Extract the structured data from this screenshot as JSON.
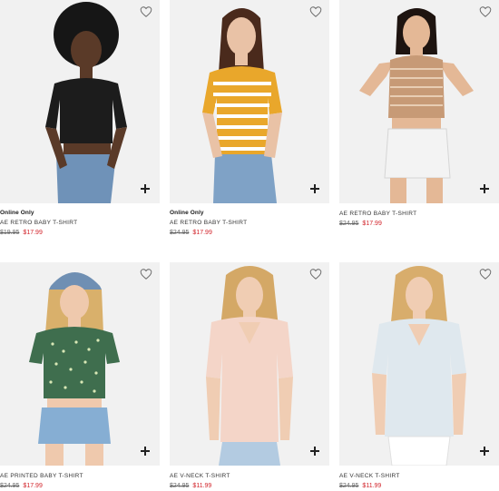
{
  "accent_color": "#d2232a",
  "products": [
    {
      "flag": "Online Only",
      "name": "AE RETRO BABY T-SHIRT",
      "old_price": "$19.95",
      "sale_price": "$17.99",
      "top_color": "#1c1c1c",
      "icons": [
        "heart-outline-icon",
        "plus-icon"
      ]
    },
    {
      "flag": "Online Only",
      "name": "AE RETRO BABY T-SHIRT",
      "old_price": "$24.95",
      "sale_price": "$17.99",
      "top_color": "#e9a72b",
      "icons": [
        "heart-outline-icon",
        "plus-icon"
      ]
    },
    {
      "flag": "",
      "name": "AE RETRO BABY T-SHIRT",
      "old_price": "$24.95",
      "sale_price": "$17.99",
      "top_color": "#c79a76",
      "icons": [
        "heart-outline-icon",
        "plus-icon"
      ]
    },
    {
      "flag": "",
      "name": "AE PRINTED BABY T-SHIRT",
      "old_price": "$24.95",
      "sale_price": "$17.99",
      "top_color": "#3f6e4e",
      "icons": [
        "heart-outline-icon",
        "plus-icon"
      ]
    },
    {
      "flag": "",
      "name": "AE V-NECK T-SHIRT",
      "old_price": "$24.95",
      "sale_price": "$11.99",
      "top_color": "#f4d5c8",
      "icons": [
        "heart-outline-icon",
        "plus-icon"
      ]
    },
    {
      "flag": "",
      "name": "AE V-NECK T-SHIRT",
      "old_price": "$24.95",
      "sale_price": "$11.99",
      "top_color": "#dfe8ee",
      "icons": [
        "heart-outline-icon",
        "plus-icon"
      ]
    }
  ]
}
